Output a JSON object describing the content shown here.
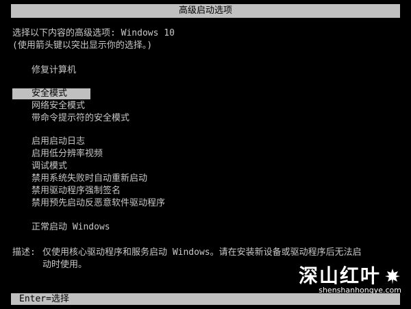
{
  "header": {
    "title": "高级启动选项"
  },
  "intro": {
    "line1": "选择以下内容的高级选项: Windows 10",
    "line2": "(使用箭头键以突出显示你的选择。)"
  },
  "menu": {
    "items": [
      {
        "label": "修复计算机"
      },
      {
        "label": "安全模式",
        "selected": true
      },
      {
        "label": "网络安全模式"
      },
      {
        "label": "带命令提示符的安全模式"
      },
      {
        "label": "启用启动日志"
      },
      {
        "label": "启用低分辨率视频"
      },
      {
        "label": "调试模式"
      },
      {
        "label": "禁用系统失败时自动重新启动"
      },
      {
        "label": "禁用驱动程序强制签名"
      },
      {
        "label": "禁用预先启动反恶意软件驱动程序"
      },
      {
        "label": "正常启动 Windows"
      }
    ]
  },
  "description": {
    "label": "描述:",
    "line1": "仅使用核心驱动程序和服务启动 Windows。请在安装新设备或驱动程序后无法启",
    "line2": "动时使用。"
  },
  "footer": {
    "hint": "Enter=选择"
  },
  "watermark": {
    "logo": "深山红叶",
    "url": "shenshanhongye.com"
  },
  "colors": {
    "background": "#000000",
    "text": "#c8c8c8",
    "highlight_bg": "#c0c0c0",
    "highlight_text": "#000000"
  },
  "icons": {
    "watermark_mark": "maple-leaf-icon"
  }
}
